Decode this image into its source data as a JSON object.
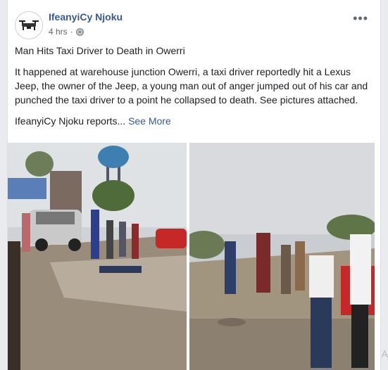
{
  "post": {
    "author": "IfeanyiCy Njoku",
    "time": "4 hrs",
    "separator": "·",
    "title": "Man Hits Taxi Driver to Death in Owerri",
    "body": "It happened at warehouse junction Owerri, a taxi driver reportedly hit a Lexus Jeep, the owner of the Jeep, a young man out of anger jumped out of his car and punched the taxi driver to a point he collapsed to death. See pictures attached.",
    "footer_text": "IfeanyiCy Njoku reports...",
    "see_more": "See More"
  },
  "icons": {
    "avatar": "drone-icon",
    "privacy": "globe-icon",
    "options": "more-options-icon"
  },
  "colors": {
    "link": "#385898",
    "text": "#1c1e21",
    "muted": "#616770",
    "background": "#e9ebee"
  },
  "edge_glyph": "A"
}
